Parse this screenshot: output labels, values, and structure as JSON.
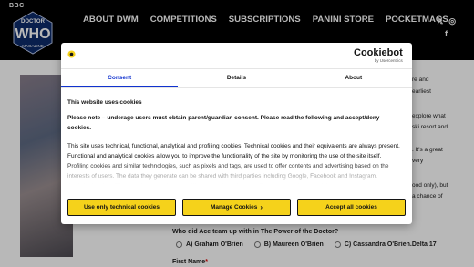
{
  "header": {
    "bbc": "BBC",
    "logo_text": [
      "DOCTOR",
      "WHO",
      "MAGAZINE"
    ],
    "nav": [
      "ABOUT DWM",
      "COMPETITIONS",
      "SUBSCRIPTIONS",
      "PANINI STORE",
      "POCKETMAGS"
    ],
    "social": {
      "x": "𝕏",
      "instagram": "◎",
      "facebook": "f"
    }
  },
  "article": {
    "snippets": [
      "re and",
      "earliest",
      "explore what",
      "ski resort and",
      ". It's a great",
      "very",
      "ood only), but",
      "a chance of"
    ],
    "question": "Who did Ace team up with in The Power of the Doctor?",
    "answers": [
      "A) Graham O'Brien",
      "B) Maureen O'Brien",
      "C) Cassandra O'Brien.Delta 17"
    ],
    "first_name_label": "First Name",
    "required_mark": "*"
  },
  "cookie_dialog": {
    "brand": "Cookiebot",
    "brand_sub": "by Usercentrics",
    "close": "×",
    "tabs": [
      "Consent",
      "Details",
      "About"
    ],
    "active_tab": 0,
    "heading": "This website uses cookies",
    "warning": "Please note – underage users must obtain parent/guardian consent. Please read the following and accept/deny cookies.",
    "text": "This site uses technical, functional, analytical and profiling cookies. Technical cookies and their equivalents are always present.  Functional and analytical cookies allow you to improve the functionality of the site by monitoring the use of the site itself.  Profiling cookies and similar technologies, such as pixels and tags, are used to offer contents and advertising based on the interests of users.  The data they generate can be shared with third parties including Google, Facebook and Instagram. Analytical and profiling cookies are only used with consent from the user.  To consent to the use of these",
    "buttons": {
      "technical": "Use only technical cookies",
      "manage": "Manage Cookies",
      "manage_chevron": "›",
      "accept": "Accept all cookies"
    }
  },
  "colors": {
    "accent": "#1032cf",
    "button": "#f5d21b",
    "header_bg": "#000000"
  }
}
